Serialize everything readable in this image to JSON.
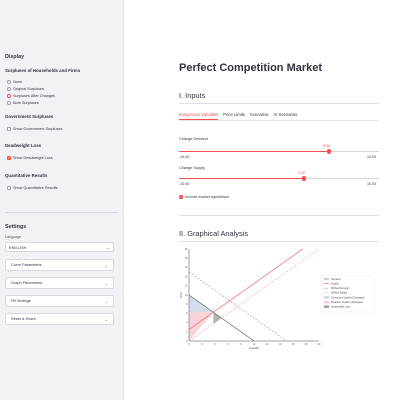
{
  "sidebar": {
    "display_heading": "Display",
    "surpluses_heading": "Surpluses of Households and Firms",
    "radio_options": [
      {
        "label": "None",
        "selected": false
      },
      {
        "label": "Original Surpluses",
        "selected": false
      },
      {
        "label": "Surpluses After Changes",
        "selected": true
      },
      {
        "label": "Both Surpluses",
        "selected": false
      }
    ],
    "gov_heading": "Government Surpluses",
    "gov_check": {
      "label": "Show Government Surpluses",
      "checked": false
    },
    "dwl_heading": "Deadweight Loss",
    "dwl_check": {
      "label": "Show Deadweight Loss",
      "checked": true
    },
    "quant_heading": "Quantitative Results",
    "quant_check": {
      "label": "Show Quantitative Results",
      "checked": false
    },
    "settings_title": "Settings",
    "language_label": "Language",
    "language_value": "ENGLISH",
    "expanders": [
      "Curve Parameters",
      "Graph Parameters",
      "Fill Settings",
      "Reset & Share"
    ]
  },
  "main": {
    "title": "Perfect Competition Market",
    "inputs_title": "I. Inputs",
    "tabs": [
      {
        "label": "Exogenous Variables",
        "active": true
      },
      {
        "label": "Price Limits",
        "active": false
      },
      {
        "label": "Scenarios",
        "active": false
      },
      {
        "label": "AI Scenarios",
        "active": false
      }
    ],
    "slider_demand": {
      "label": "Change Demand",
      "value": "5.00",
      "min": "-10.00",
      "max": "10.00",
      "fraction": 0.75
    },
    "slider_supply": {
      "label": "Change Supply",
      "value": "2.50",
      "min": "-10.00",
      "max": "10.00",
      "fraction": 0.625
    },
    "checkbox_label": "Include market equilibrium",
    "analysis_title": "II. Graphical Analysis"
  },
  "colors": {
    "accent": "#ff4b4b"
  },
  "chart_data": {
    "type": "line",
    "xlabel": "Quantity",
    "ylabel": "Price",
    "xlim": [
      0,
      20
    ],
    "ylim": [
      0,
      20
    ],
    "x_ticks": [
      0,
      2,
      4,
      6,
      8,
      10,
      12,
      14,
      16,
      18,
      20
    ],
    "y_ticks": [
      0,
      2,
      4,
      6,
      8,
      10,
      12,
      14,
      16,
      18,
      20
    ],
    "legend_position": "right",
    "series": [
      {
        "name": "Demand",
        "style": "solid",
        "color": "#555555",
        "points": [
          [
            0,
            10
          ],
          [
            10,
            0
          ]
        ]
      },
      {
        "name": "Supply",
        "style": "solid",
        "color": "#ff4b4b",
        "points": [
          [
            0,
            2.5
          ],
          [
            17.5,
            20
          ]
        ]
      },
      {
        "name": "Shifted Demand",
        "style": "dashed",
        "color": "#999999",
        "points": [
          [
            0,
            15
          ],
          [
            15,
            0
          ]
        ]
      },
      {
        "name": "Shifted Supply",
        "style": "dashed",
        "color": "#ff9b9b",
        "points": [
          [
            0,
            0
          ],
          [
            20,
            20
          ]
        ]
      }
    ],
    "fills": [
      {
        "name": "Consumer Surplus (Changed)",
        "color": "#c9d2e6",
        "polygon": [
          [
            0,
            10
          ],
          [
            3.75,
            6.25
          ],
          [
            0,
            6.25
          ]
        ]
      },
      {
        "name": "Producer Surplus (Changed)",
        "color": "#f6c8d0",
        "polygon": [
          [
            0,
            6.25
          ],
          [
            3.75,
            6.25
          ],
          [
            0,
            0
          ]
        ]
      },
      {
        "name": "Deadweight Loss",
        "color": "#9aa59a",
        "polygon": [
          [
            3.75,
            6.25
          ],
          [
            5,
            5
          ],
          [
            3.75,
            3.75
          ]
        ]
      }
    ],
    "legend": [
      "Demand",
      "Supply",
      "Shifted Demand",
      "Shifted Supply",
      "Consumer Surplus (Changed)",
      "Producer Surplus (Changed)",
      "Deadweight Loss"
    ]
  }
}
